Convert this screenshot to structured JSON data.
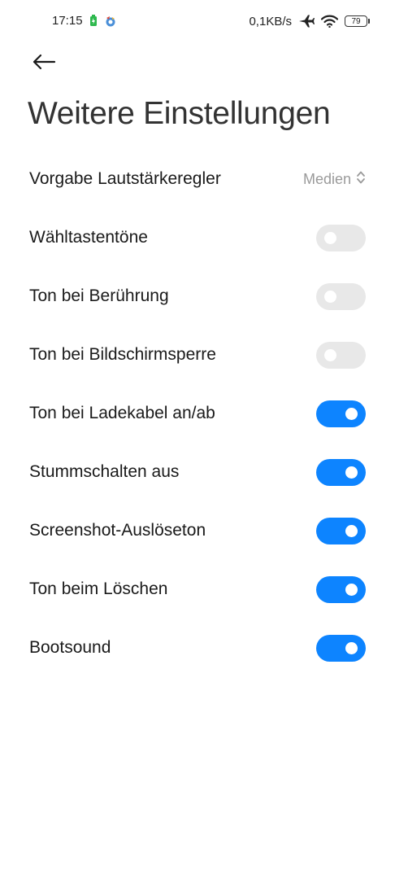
{
  "status_bar": {
    "time": "17:15",
    "network_speed": "0,1KB/s",
    "battery_level": "79",
    "icons": [
      "battery-saver-icon",
      "app-notification-icon",
      "airplane-mode-icon",
      "wifi-icon",
      "battery-icon"
    ]
  },
  "header": {
    "back_icon": "arrow-left-icon",
    "title": "Weitere Einstellungen"
  },
  "settings": {
    "volume_default": {
      "label": "Vorgabe Lautstärkeregler",
      "value": "Medien",
      "icon": "chevron-up-down-icon"
    },
    "items": [
      {
        "label": "Wähltastentöne",
        "enabled": false
      },
      {
        "label": "Ton bei Berührung",
        "enabled": false
      },
      {
        "label": "Ton bei Bildschirmsperre",
        "enabled": false
      },
      {
        "label": "Ton bei Ladekabel an/ab",
        "enabled": true
      },
      {
        "label": "Stummschalten aus",
        "enabled": true
      },
      {
        "label": "Screenshot-Auslöseton",
        "enabled": true
      },
      {
        "label": "Ton beim Löschen",
        "enabled": true
      },
      {
        "label": "Bootsound",
        "enabled": true
      }
    ]
  },
  "colors": {
    "toggle_on": "#0d84ff",
    "toggle_off": "#e8e8e8",
    "title": "#333333",
    "secondary_text": "#9a9a9a"
  }
}
